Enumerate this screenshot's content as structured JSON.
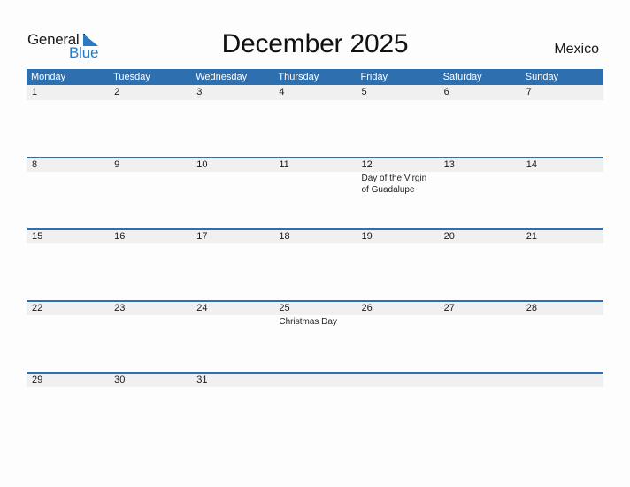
{
  "logo": {
    "word1": "General",
    "word2": "Blue"
  },
  "header": {
    "title": "December 2025",
    "country": "Mexico"
  },
  "colors": {
    "accent": "#2e6fb0",
    "logo_blue": "#2a7bc4",
    "date_strip": "#f0f0f0"
  },
  "weekdays": [
    "Monday",
    "Tuesday",
    "Wednesday",
    "Thursday",
    "Friday",
    "Saturday",
    "Sunday"
  ],
  "weeks": [
    {
      "days": [
        "1",
        "2",
        "3",
        "4",
        "5",
        "6",
        "7"
      ],
      "events": [
        "",
        "",
        "",
        "",
        "",
        "",
        ""
      ]
    },
    {
      "days": [
        "8",
        "9",
        "10",
        "11",
        "12",
        "13",
        "14"
      ],
      "events": [
        "",
        "",
        "",
        "",
        "Day of the Virgin of Guadalupe",
        "",
        ""
      ]
    },
    {
      "days": [
        "15",
        "16",
        "17",
        "18",
        "19",
        "20",
        "21"
      ],
      "events": [
        "",
        "",
        "",
        "",
        "",
        "",
        ""
      ]
    },
    {
      "days": [
        "22",
        "23",
        "24",
        "25",
        "26",
        "27",
        "28"
      ],
      "events": [
        "",
        "",
        "",
        "Christmas Day",
        "",
        "",
        ""
      ]
    },
    {
      "days": [
        "29",
        "30",
        "31",
        "",
        "",
        "",
        ""
      ],
      "events": [
        "",
        "",
        "",
        "",
        "",
        "",
        ""
      ]
    }
  ]
}
